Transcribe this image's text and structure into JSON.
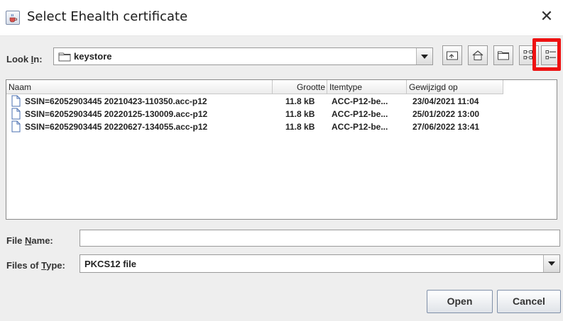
{
  "window": {
    "title": "Select Ehealth certificate",
    "close_glyph": "✕",
    "app_icon": "java-cup-icon"
  },
  "look_in": {
    "label_prefix": "Look ",
    "label_mnemonic": "I",
    "label_suffix": "n:",
    "value": "keystore",
    "value_icon": "folder-icon"
  },
  "toolbar": [
    {
      "name": "up-one-level-button",
      "icon": "up-folder-icon"
    },
    {
      "name": "home-button",
      "icon": "home-icon"
    },
    {
      "name": "new-folder-button",
      "icon": "new-folder-icon"
    },
    {
      "name": "list-view-button",
      "icon": "list-view-icon"
    },
    {
      "name": "details-view-button",
      "icon": "details-view-icon",
      "highlighted": true
    }
  ],
  "highlight_color": "#ee1111",
  "file_list": {
    "columns": [
      "Naam",
      "Grootte",
      "Itemtype",
      "Gewijzigd op"
    ],
    "rows": [
      {
        "name": "SSIN=62052903445 20210423-110350.acc-p12",
        "size": "11.8 kB",
        "type": "ACC-P12-be...",
        "modified": "23/04/2021 11:04"
      },
      {
        "name": "SSIN=62052903445 20220125-130009.acc-p12",
        "size": "11.8 kB",
        "type": "ACC-P12-be...",
        "modified": "25/01/2022 13:00"
      },
      {
        "name": "SSIN=62052903445 20220627-134055.acc-p12",
        "size": "11.8 kB",
        "type": "ACC-P12-be...",
        "modified": "27/06/2022 13:41"
      }
    ]
  },
  "file_name": {
    "label_prefix": "File ",
    "label_mnemonic": "N",
    "label_suffix": "ame:",
    "value": ""
  },
  "file_type": {
    "label_prefix": "Files of ",
    "label_mnemonic": "T",
    "label_suffix": "ype:",
    "value": "PKCS12 file"
  },
  "buttons": {
    "open": "Open",
    "cancel": "Cancel"
  }
}
